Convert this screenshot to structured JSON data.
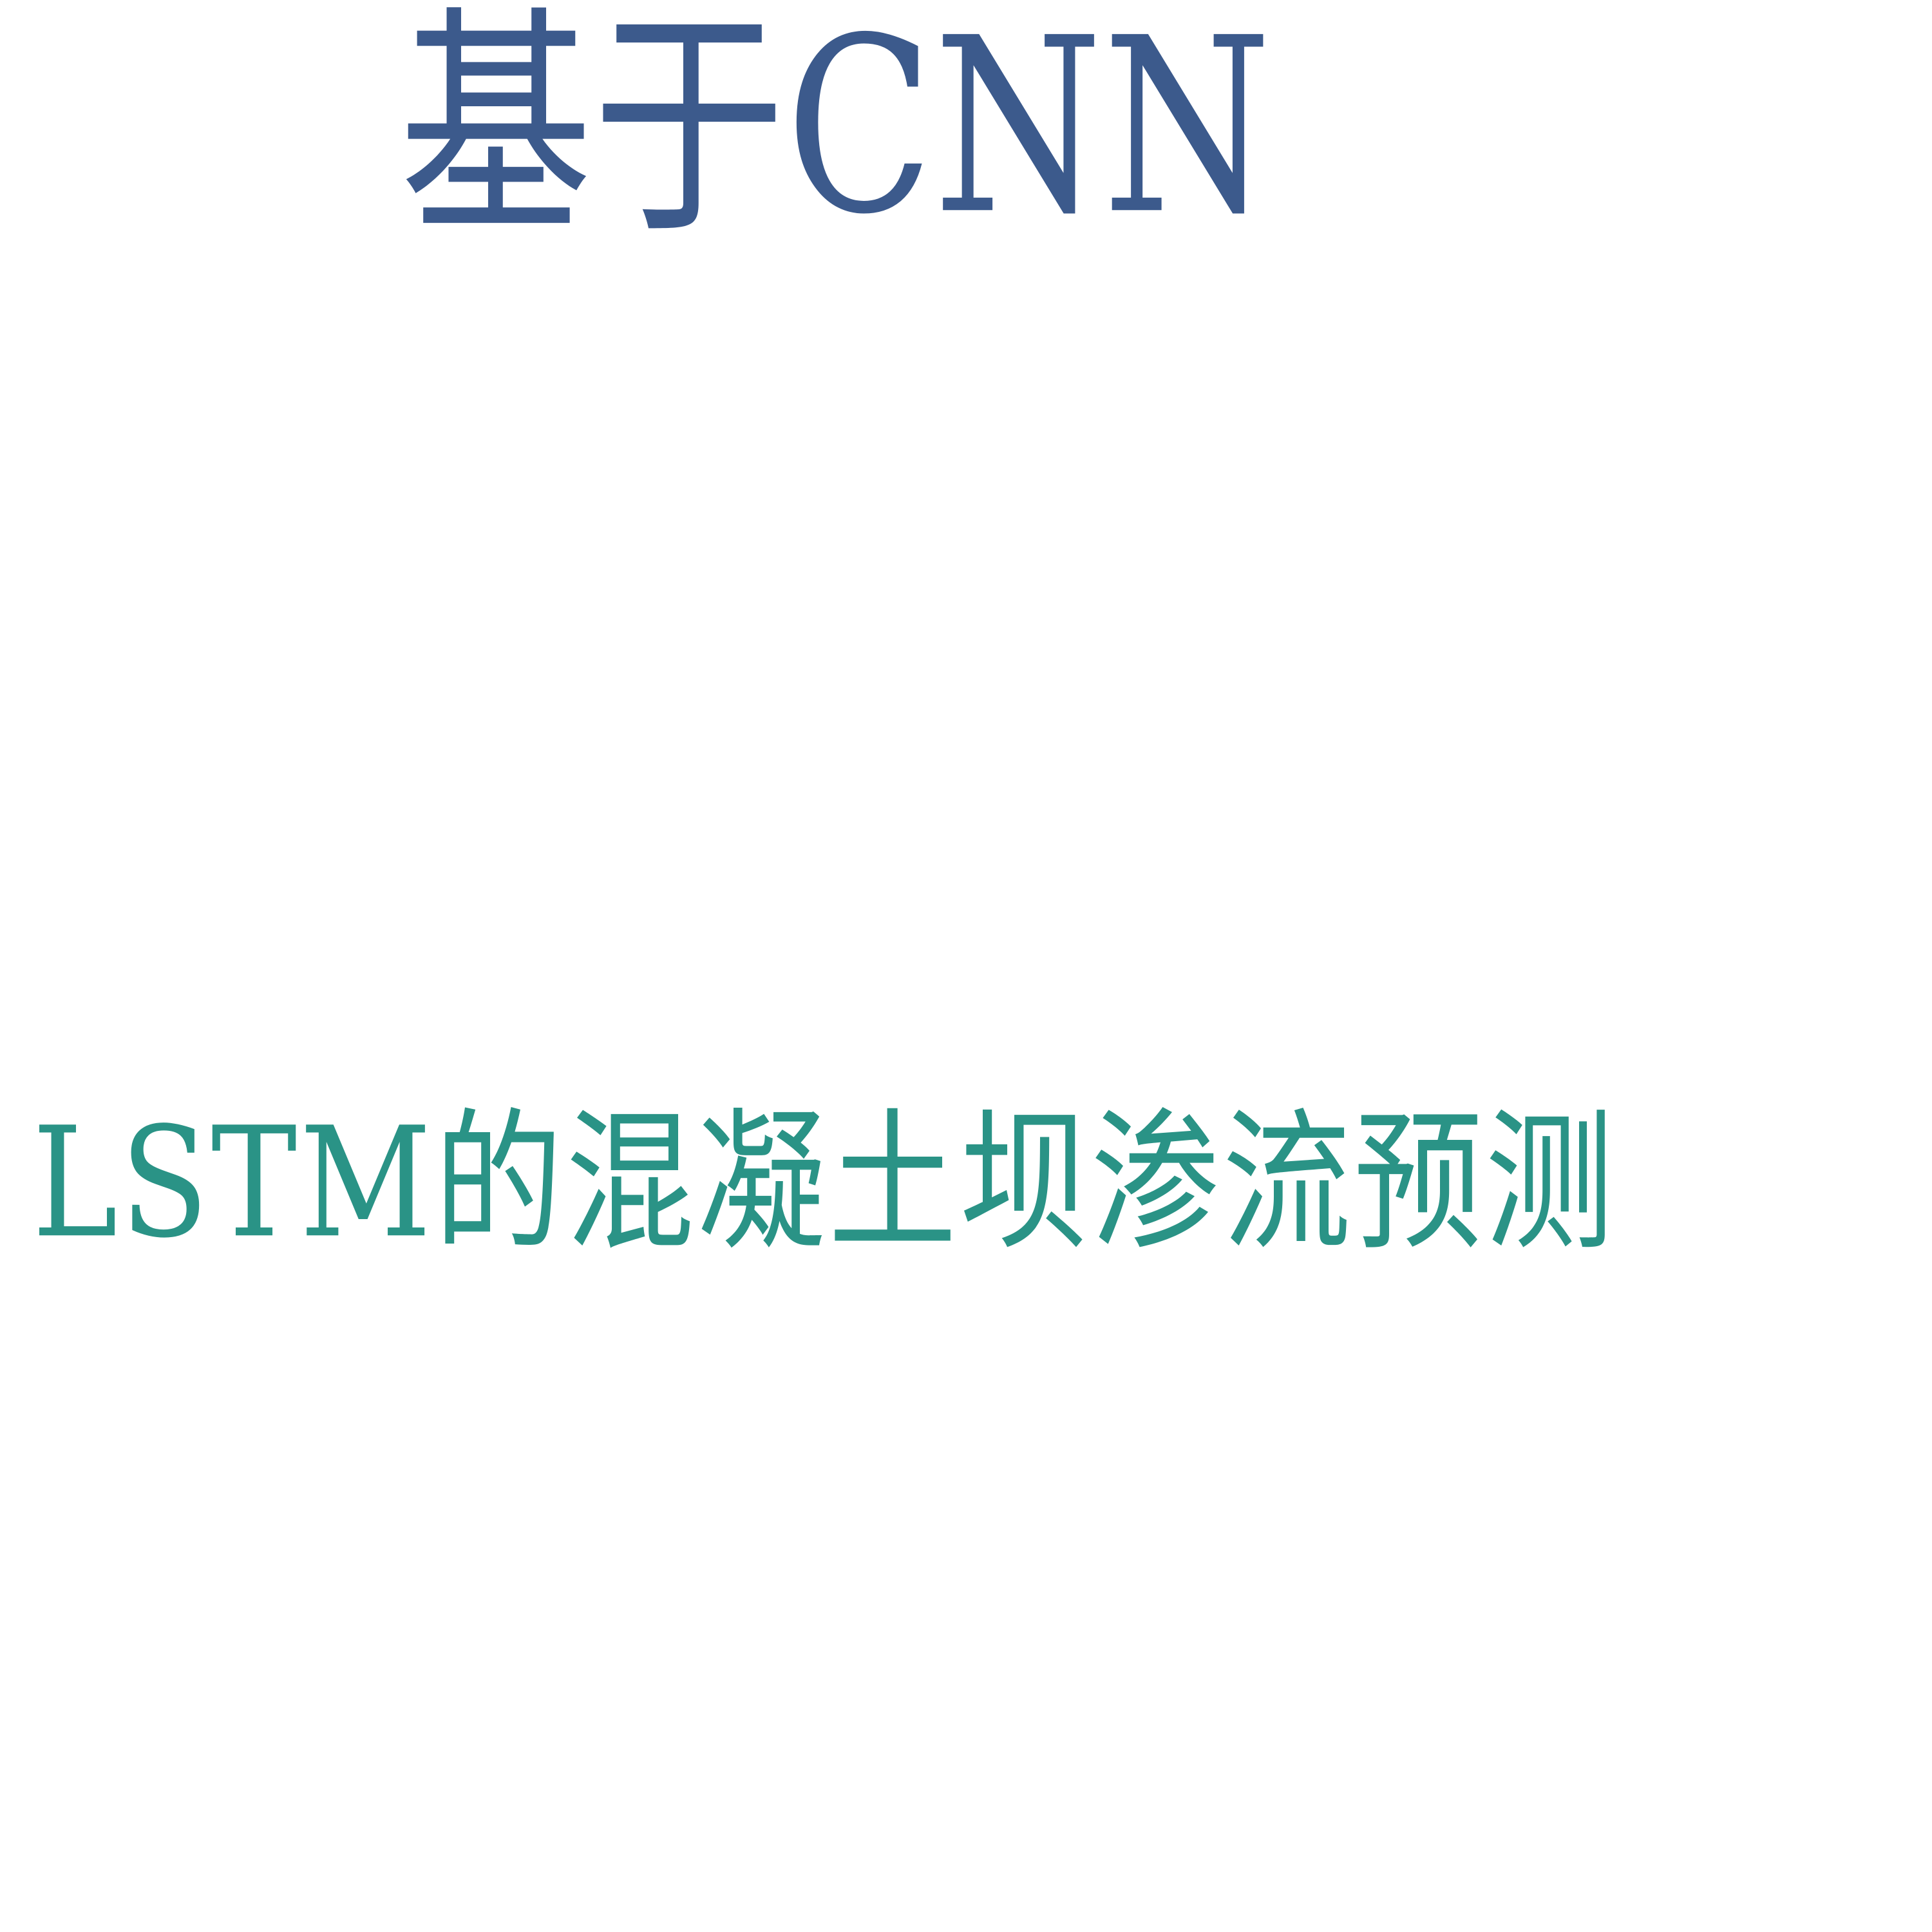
{
  "document": {
    "title_line_1": "基于CNN",
    "title_line_2": "LSTM的混凝土坝渗流预测"
  },
  "colors": {
    "title_line_1": "#3c5a8c",
    "title_line_2": "#2a9386",
    "background": "#ffffff"
  }
}
